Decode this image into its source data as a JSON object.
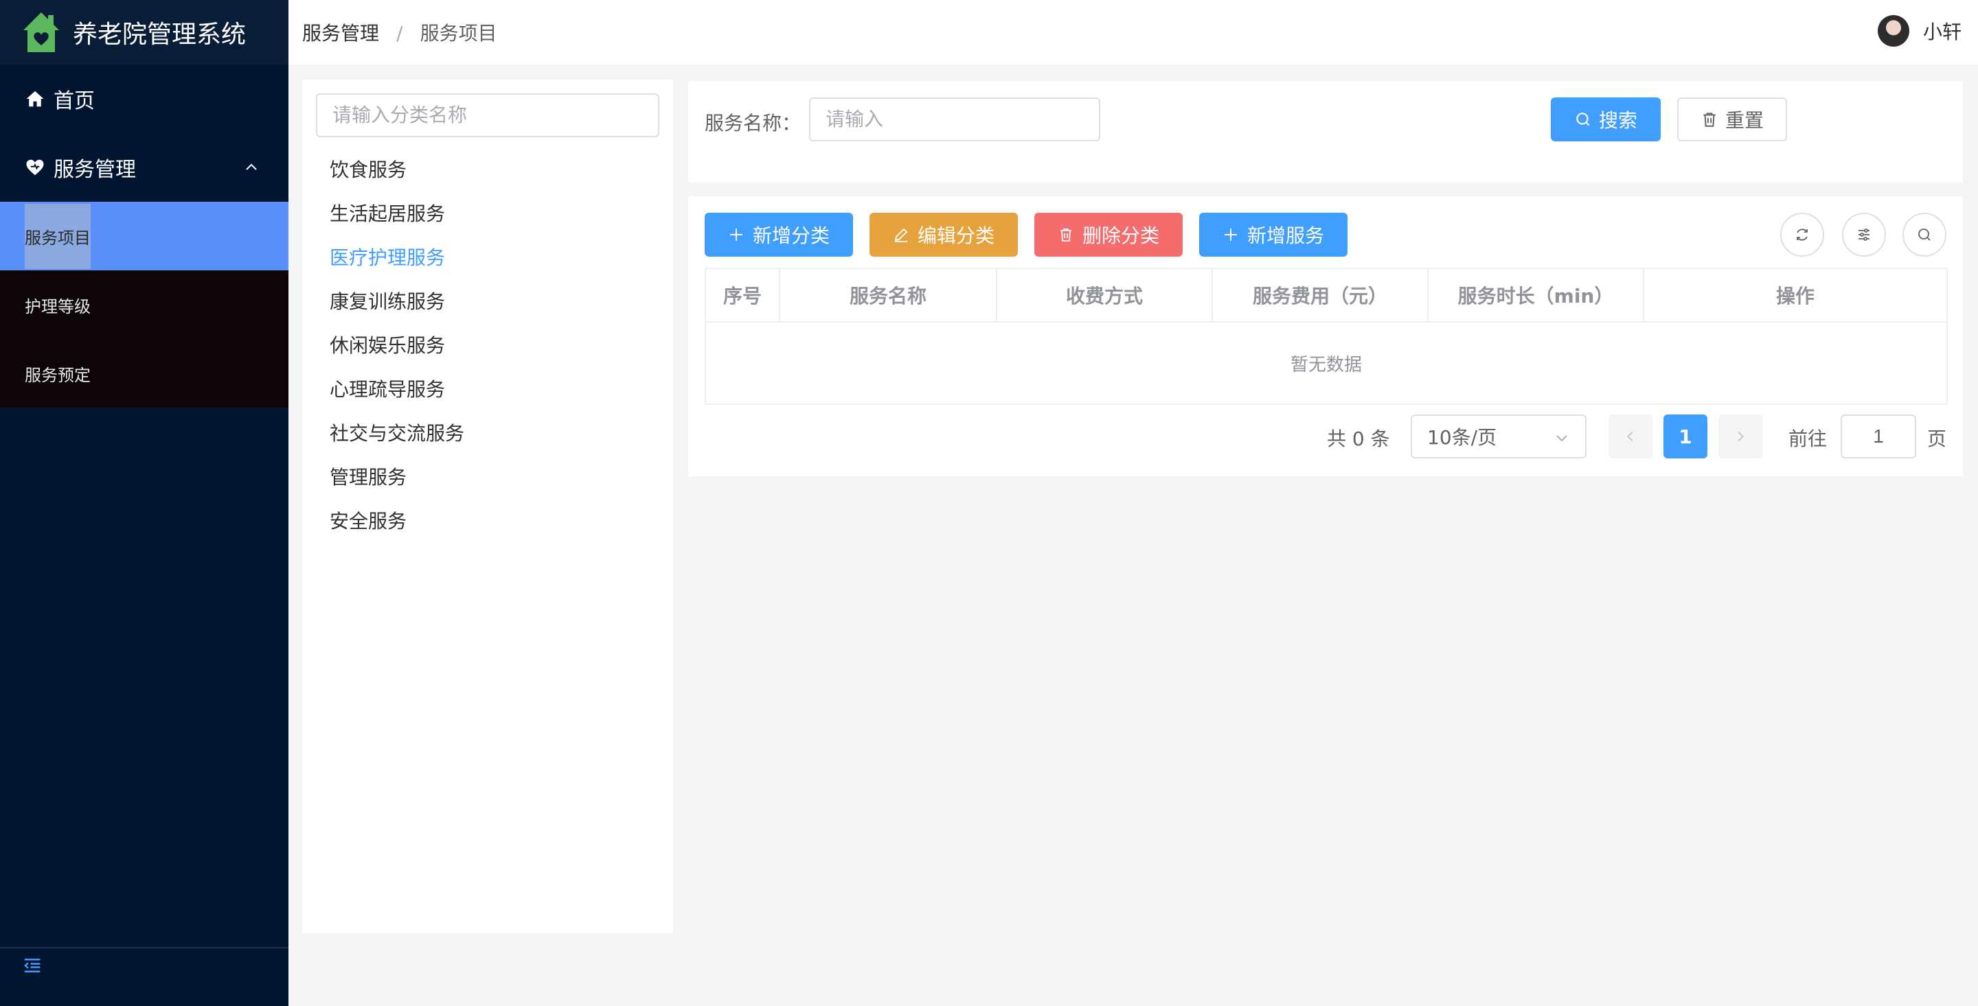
{
  "app": {
    "title": "养老院管理系统"
  },
  "sidebar": {
    "home_label": "首页",
    "group_label": "服务管理",
    "sub_items": [
      {
        "label": "服务项目",
        "active": true
      },
      {
        "label": "护理等级",
        "active": false
      },
      {
        "label": "服务预定",
        "active": false
      }
    ]
  },
  "header": {
    "breadcrumb": [
      "服务管理",
      "服务项目"
    ],
    "separator": "/",
    "user_name": "小轩"
  },
  "category_panel": {
    "search_placeholder": "请输入分类名称",
    "categories": [
      "饮食服务",
      "生活起居服务",
      "医疗护理服务",
      "康复训练服务",
      "休闲娱乐服务",
      "心理疏导服务",
      "社交与交流服务",
      "管理服务",
      "安全服务"
    ],
    "active_index": 2
  },
  "search_form": {
    "label": "服务名称：",
    "placeholder": "请输入",
    "search_button": "搜索",
    "reset_button": "重置"
  },
  "toolbar": {
    "add_category": "新增分类",
    "edit_category": "编辑分类",
    "delete_category": "删除分类",
    "add_service": "新增服务"
  },
  "table": {
    "columns": [
      "序号",
      "服务名称",
      "收费方式",
      "服务费用（元）",
      "服务时长（min）",
      "操作"
    ],
    "empty_text": "暂无数据"
  },
  "pagination": {
    "total_text": "共 0 条",
    "page_size": "10条/页",
    "current_page": "1",
    "goto_label": "前往",
    "goto_value": "1",
    "goto_suffix": "页"
  },
  "colors": {
    "sidebar_bg": "#011430",
    "primary": "#409eff",
    "warning": "#e6a23c",
    "danger": "#f56c6c",
    "active_submenu": "#5b8ff9"
  }
}
